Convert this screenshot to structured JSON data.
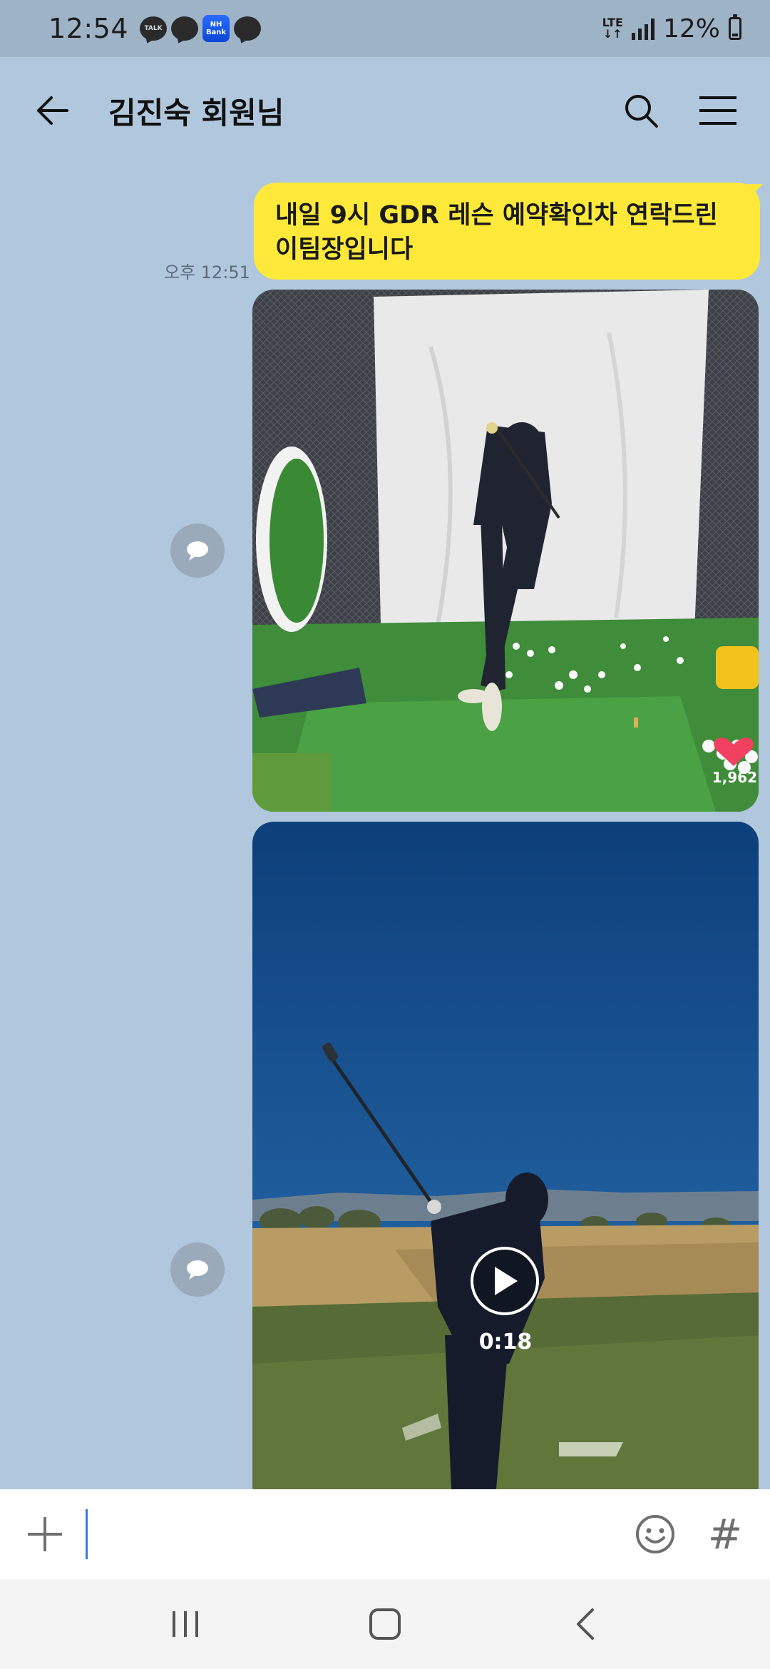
{
  "status_bar": {
    "time": "12:54",
    "notifications": [
      {
        "icon": "talk-bubble-icon",
        "text": "TALK"
      },
      {
        "icon": "chat-bubble-icon",
        "text": ""
      },
      {
        "icon": "nh-bank-icon",
        "text": "NH Bank"
      },
      {
        "icon": "chat-bubble-icon",
        "text": ""
      }
    ],
    "network": "LTE",
    "battery": "12%"
  },
  "header": {
    "title": "김진숙 회원님",
    "back_icon": "back-arrow-icon",
    "search_icon": "search-icon",
    "menu_icon": "menu-icon"
  },
  "messages": [
    {
      "type": "text",
      "sender": "me",
      "text_line1": "내일 9시 GDR 레슨 예약확인차 연락드린",
      "text_line2": "이팀장입니다",
      "time": "오후 12:51",
      "bubble_color": "#fee93b"
    },
    {
      "type": "image",
      "sender": "me",
      "description": "golf swing in indoor net",
      "like_count": "1,962"
    },
    {
      "type": "video",
      "sender": "me",
      "duration": "0:18"
    }
  ],
  "input_bar": {
    "value": "",
    "hash_label": "#",
    "plus_icon": "plus-icon",
    "emoji_icon": "emoji-icon"
  },
  "nav_bar": {
    "recents_icon": "recents-icon",
    "home_icon": "home-icon",
    "back_icon": "nav-back-icon"
  },
  "colors": {
    "chat_background": "#b1c7dd",
    "status_bar": "#9fb3c6",
    "my_bubble": "#fee93b"
  }
}
